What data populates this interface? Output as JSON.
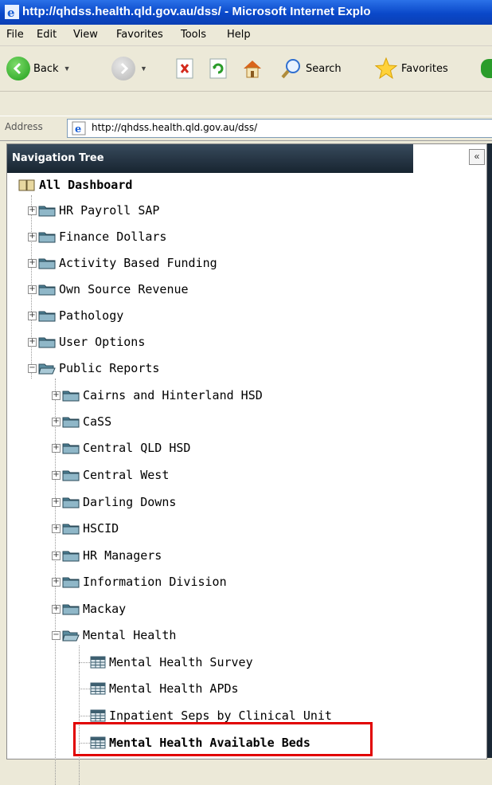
{
  "window": {
    "title": "http://qhdss.health.qld.gov.au/dss/ - Microsoft Internet Explo"
  },
  "menu": [
    "File",
    "Edit",
    "View",
    "Favorites",
    "Tools",
    "Help"
  ],
  "toolbar": {
    "back": "Back",
    "search": "Search",
    "favorites": "Favorites"
  },
  "address": {
    "label": "Address",
    "url": "http://qhdss.health.qld.gov.au/dss/"
  },
  "nav": {
    "title": "Navigation Tree",
    "collapse": "«",
    "root": "All Dashboard",
    "top_folders": [
      "HR Payroll SAP",
      "Finance Dollars",
      "Activity Based Funding",
      "Own Source Revenue",
      "Pathology",
      "User Options"
    ],
    "public_reports": "Public Reports",
    "sub_folders": [
      "Cairns and Hinterland HSD",
      "CaSS",
      "Central QLD HSD",
      "Central West",
      "Darling Downs",
      "HSCID",
      "HR Managers",
      "Information Division",
      "Mackay"
    ],
    "mental_health": "Mental Health",
    "reports": [
      "Mental Health Survey",
      "Mental Health APDs",
      "Inpatient Seps by Clinical Unit",
      "Mental Health Available Beds"
    ]
  },
  "colors": {
    "highlight": "#e10000",
    "titlebar": "#0a48c9"
  }
}
